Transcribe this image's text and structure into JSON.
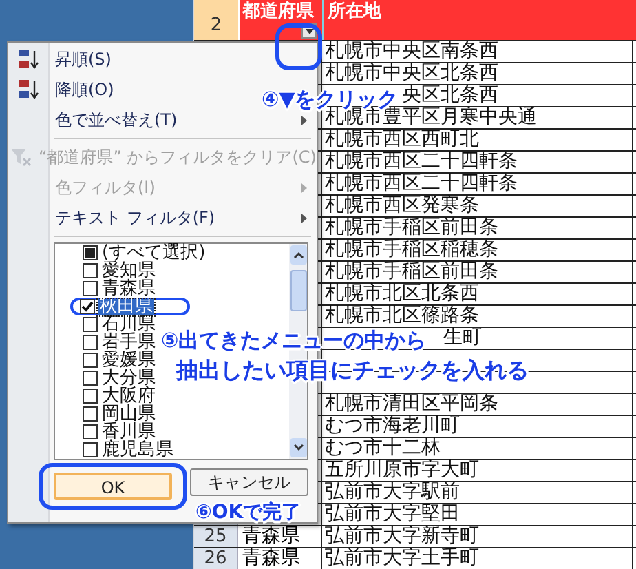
{
  "header": {
    "row_number": "2",
    "columns": [
      "都道府県",
      "所在地"
    ]
  },
  "rows": [
    {
      "address": "札幌市中央区南条西"
    },
    {
      "address": "札幌市中央区北条西"
    },
    {
      "address": "央区北条西"
    },
    {
      "address": "札幌市豊平区月寒中央通"
    },
    {
      "address": "札幌市西区西町北"
    },
    {
      "address": "札幌市西区二十四軒条"
    },
    {
      "address": "札幌市西区二十四軒条"
    },
    {
      "address": "札幌市西区発寒条"
    },
    {
      "address": "札幌市手稲区前田条"
    },
    {
      "address": "札幌市手稲区稲穂条"
    },
    {
      "address": "札幌市手稲区前田条"
    },
    {
      "address": "札幌市北区北条西"
    },
    {
      "address": "札幌市北区篠路条"
    },
    {
      "address": "生町"
    },
    {},
    {},
    {
      "address": "札幌市清田区平岡条"
    },
    {
      "address": "むつ市海老川町"
    },
    {
      "address": "むつ市十二林"
    },
    {
      "address": "五所川原市字大町"
    },
    {
      "address": "弘前市大字駅前"
    },
    {
      "address": "弘前市大字堅田"
    },
    {
      "number": "25",
      "prefecture": "青森県",
      "address": "弘前市大字新寺町"
    },
    {
      "number": "26",
      "prefecture": "青森県",
      "address": "弘前市大字土手町"
    }
  ],
  "menu": {
    "items": [
      {
        "kind": "sort-asc",
        "label": "昇順(S)",
        "disabled": false,
        "submenu": false
      },
      {
        "kind": "sort-desc",
        "label": "降順(O)",
        "disabled": false,
        "submenu": false
      },
      {
        "kind": "plain",
        "label": "色で並べ替え(T)",
        "disabled": false,
        "submenu": true
      },
      {
        "kind": "separator"
      },
      {
        "kind": "clear-filter",
        "label": "“都道府県” からフィルタをクリア(C)",
        "disabled": true,
        "submenu": false
      },
      {
        "kind": "plain",
        "label": "色フィルタ(I)",
        "disabled": true,
        "submenu": true
      },
      {
        "kind": "plain",
        "label": "テキスト フィルタ(F)",
        "disabled": false,
        "submenu": true
      },
      {
        "kind": "separator"
      }
    ],
    "select_all": {
      "label": "(すべて選択)",
      "partial": true
    },
    "list": [
      {
        "label": "愛知県",
        "checked": false,
        "selected": false
      },
      {
        "label": "青森県",
        "checked": false,
        "selected": false
      },
      {
        "label": "秋田県",
        "checked": true,
        "selected": true
      },
      {
        "label": "石川県",
        "checked": false,
        "selected": false
      },
      {
        "label": "岩手県",
        "checked": false,
        "selected": false
      },
      {
        "label": "愛媛県",
        "checked": false,
        "selected": false
      },
      {
        "label": "大分県",
        "checked": false,
        "selected": false
      },
      {
        "label": "大阪府",
        "checked": false,
        "selected": false
      },
      {
        "label": "岡山県",
        "checked": false,
        "selected": false
      },
      {
        "label": "香川県",
        "checked": false,
        "selected": false
      },
      {
        "label": "鹿児島県",
        "checked": false,
        "selected": false
      }
    ],
    "buttons": [
      {
        "label": "OK",
        "focused": true
      },
      {
        "label": "キャンセル",
        "focused": false
      }
    ]
  },
  "callouts": [
    "④▼をクリック",
    "⑤出てきたメニューの中から",
    "抽出したい項目にチェックを入れる",
    "⑥OKで完了"
  ]
}
